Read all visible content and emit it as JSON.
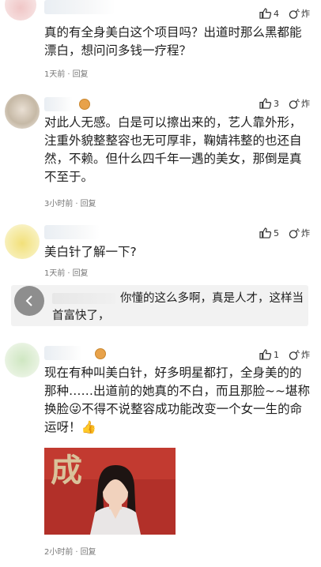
{
  "comments": [
    {
      "likes": "4",
      "zha_label": "炸",
      "text": "真的有全身美白这个项目吗？出道时那么黑都能漂白，想问问多钱一疗程？",
      "time": "1天前",
      "reply_label": "回复"
    },
    {
      "likes": "3",
      "zha_label": "炸",
      "text": "对此人无感。白是可以擦出来的，艺人靠外形，注重外貌整整容也无可厚非，鞠婧祎整的也还自然，不赖。但什么四千年一遇的美女，那倒是真不至于。",
      "time": "3小时前",
      "reply_label": "回复"
    },
    {
      "likes": "5",
      "zha_label": "炸",
      "text": "美白针了解一下?",
      "time": "1天前",
      "reply_label": "回复",
      "reply": {
        "text": "你懂的这么多啊，真是人才，这样当首富快了，"
      }
    },
    {
      "likes": "1",
      "zha_label": "炸",
      "text": "现在有种叫美白针，好多明星都打，全身美的的那种……出道前的她真的不白，而且那脸~~堪称换脸😜不得不说整容成功能改变一个女一生的命运呀！👍",
      "time": "2小时前",
      "reply_label": "回复",
      "image_caption": "成"
    }
  ],
  "icons": {
    "like": "thumbs-up-icon",
    "zha": "bomb-icon",
    "back": "chevron-left-icon",
    "vip": "vip-badge-icon"
  },
  "colors": {
    "text": "#1e1e1e",
    "meta": "#777777",
    "reply_bg": "#f2f2f2",
    "back_btn": "#8e8e8e",
    "vip": "#e8a24a"
  }
}
